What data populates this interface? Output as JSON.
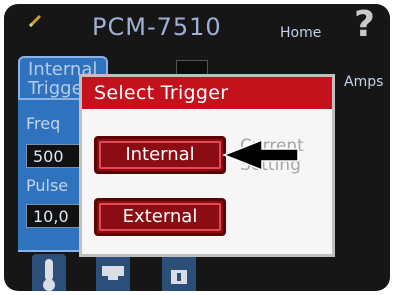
{
  "header": {
    "title": "PCM-7510",
    "home_label": "Home",
    "help_label": "?"
  },
  "background_panel": {
    "tab_line1": "Internal",
    "tab_line2": "Trigger",
    "freq_label": "Freq",
    "freq_value": "500",
    "pulse_label": "Pulse",
    "pulse_value": "10,0",
    "amps_label": "Amps"
  },
  "dialog": {
    "title": "Select Trigger",
    "options": [
      "Internal",
      "External"
    ],
    "current_setting_line1": "Current",
    "current_setting_line2": "Setting",
    "selected": "Internal"
  },
  "colors": {
    "screen_bg": "#161616",
    "title_text": "#9fb0d6",
    "panel_blue": "#2f73bf",
    "dialog_title_bg": "#c4121c",
    "button_bg": "#8c0c14"
  },
  "icons": [
    "pen-icon",
    "help-icon",
    "thermometer-icon",
    "monitor-icon",
    "info-icon",
    "pointer-arrow-icon"
  ]
}
